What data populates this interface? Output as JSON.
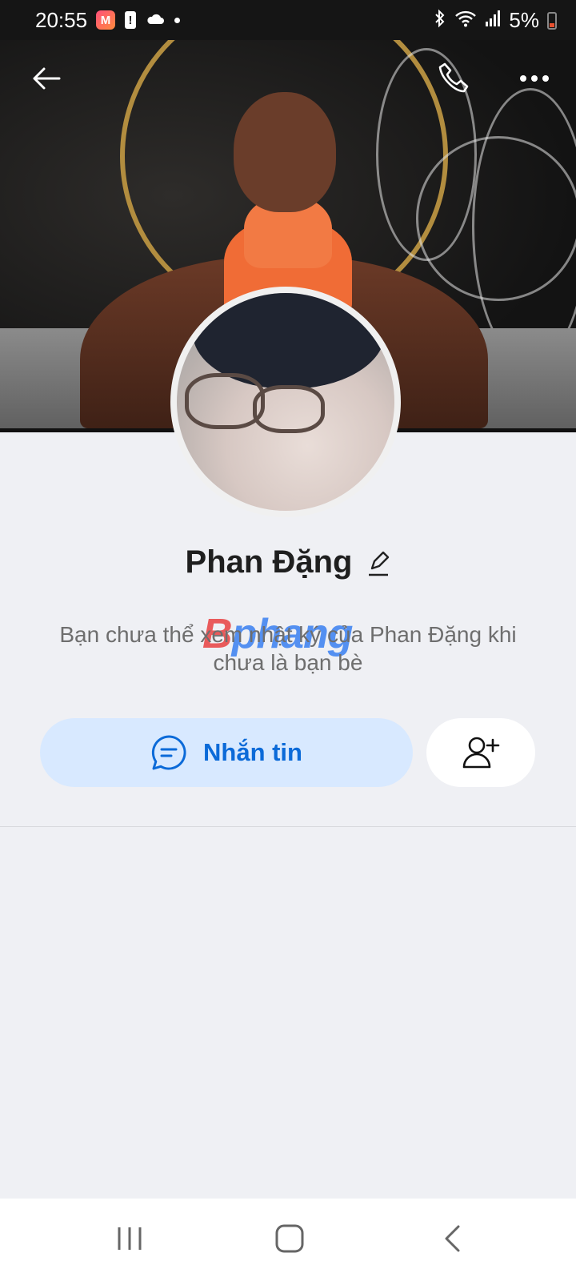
{
  "status_bar": {
    "time": "20:55",
    "app_badge": "M",
    "alert_badge": "!",
    "battery": "5%",
    "icons": [
      "app-badge-icon",
      "alert-icon",
      "cloud-icon",
      "dot-icon",
      "bluetooth-icon",
      "wifi-icon",
      "signal-icon",
      "battery-icon"
    ]
  },
  "header": {
    "icons": [
      "back-arrow-icon",
      "phone-icon",
      "more-icon"
    ]
  },
  "profile": {
    "name": "Phan Đặng",
    "privacy_notice": "Bạn chưa thể xem nhật ký của Phan Đặng khi chưa là bạn bè"
  },
  "watermark": {
    "part1": "B",
    "part2": "phang"
  },
  "actions": {
    "message_label": "Nhắn tin",
    "message_icon": "chat-bubble-icon",
    "add_friend_icon": "add-friend-icon"
  },
  "system_nav": {
    "icons": [
      "recents-icon",
      "home-icon",
      "back-chevron-icon"
    ]
  },
  "colors": {
    "accent": "#0b6ad8",
    "message_button_bg": "#d8e9ff",
    "page_bg": "#eff0f4"
  }
}
